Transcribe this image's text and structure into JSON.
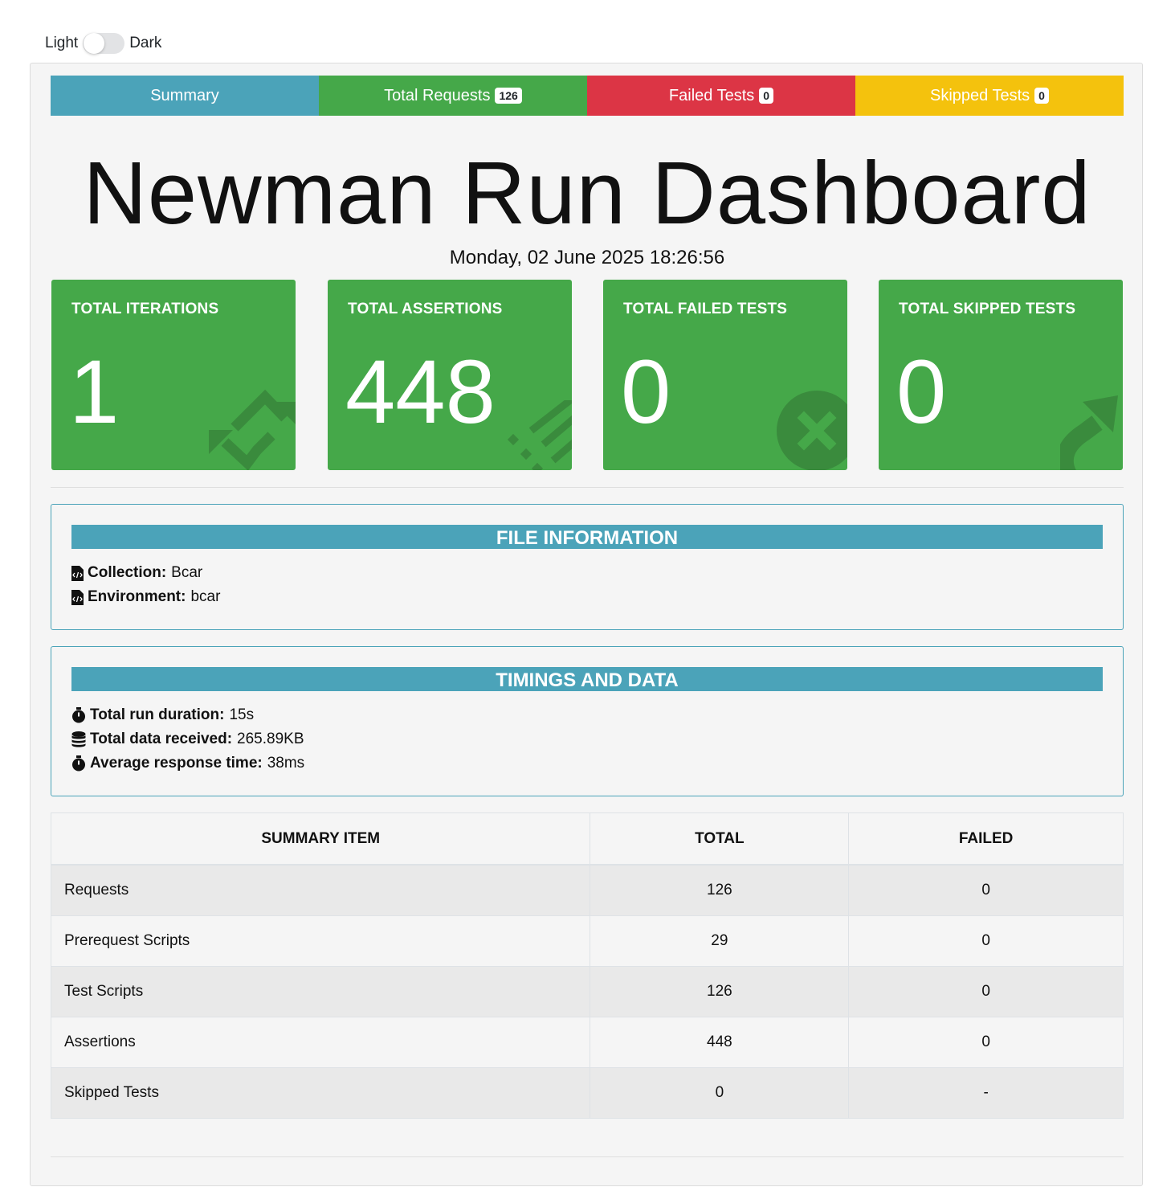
{
  "theme_toggle": {
    "light_label": "Light",
    "dark_label": "Dark"
  },
  "tabs": [
    {
      "label": "Summary",
      "badge": ""
    },
    {
      "label": "Total Requests",
      "badge": "126"
    },
    {
      "label": "Failed Tests",
      "badge": "0"
    },
    {
      "label": "Skipped Tests",
      "badge": "0"
    }
  ],
  "header": {
    "title": "Newman Run Dashboard",
    "date": "Monday, 02 June 2025 18:26:56"
  },
  "cards": [
    {
      "title": "TOTAL ITERATIONS",
      "value": "1",
      "icon": "sync-icon"
    },
    {
      "title": "TOTAL ASSERTIONS",
      "value": "448",
      "icon": "tasks-icon"
    },
    {
      "title": "TOTAL FAILED TESTS",
      "value": "0",
      "icon": "times-circle-icon"
    },
    {
      "title": "TOTAL SKIPPED TESTS",
      "value": "0",
      "icon": "share-arrow-icon"
    }
  ],
  "file_info": {
    "header": "FILE INFORMATION",
    "collection_label": "Collection:",
    "collection_value": "Bcar",
    "environment_label": "Environment:",
    "environment_value": "bcar"
  },
  "timings": {
    "header": "TIMINGS AND DATA",
    "duration_label": "Total run duration:",
    "duration_value": "15s",
    "data_label": "Total data received:",
    "data_value": "265.89KB",
    "avg_label": "Average response time:",
    "avg_value": "38ms"
  },
  "summary_table": {
    "headers": [
      "SUMMARY ITEM",
      "TOTAL",
      "FAILED"
    ],
    "rows": [
      [
        "Requests",
        "126",
        "0"
      ],
      [
        "Prerequest Scripts",
        "29",
        "0"
      ],
      [
        "Test Scripts",
        "126",
        "0"
      ],
      [
        "Assertions",
        "448",
        "0"
      ],
      [
        "Skipped Tests",
        "0",
        "-"
      ]
    ]
  },
  "colors": {
    "info": "#4ba3b9",
    "success": "#45a849",
    "danger": "#dc3545",
    "warning": "#f4c20d"
  }
}
